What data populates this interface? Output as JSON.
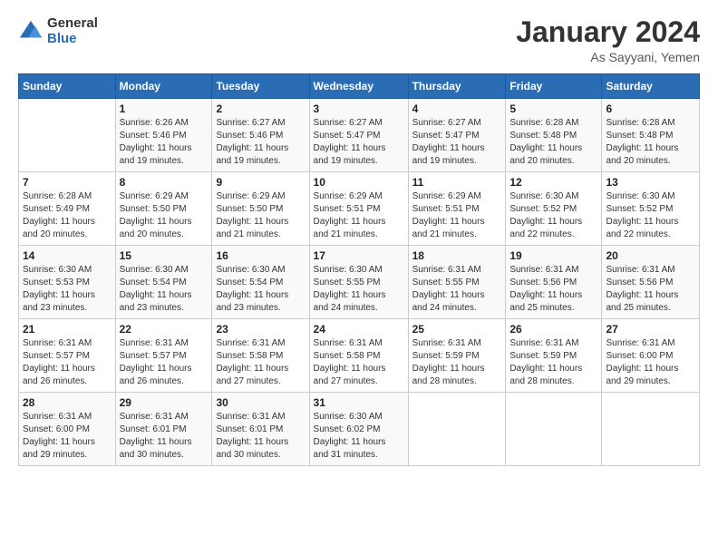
{
  "header": {
    "logo_general": "General",
    "logo_blue": "Blue",
    "month_title": "January 2024",
    "subtitle": "As Sayyani, Yemen"
  },
  "days_of_week": [
    "Sunday",
    "Monday",
    "Tuesday",
    "Wednesday",
    "Thursday",
    "Friday",
    "Saturday"
  ],
  "weeks": [
    [
      {
        "day": "",
        "info": ""
      },
      {
        "day": "1",
        "info": "Sunrise: 6:26 AM\nSunset: 5:46 PM\nDaylight: 11 hours\nand 19 minutes."
      },
      {
        "day": "2",
        "info": "Sunrise: 6:27 AM\nSunset: 5:46 PM\nDaylight: 11 hours\nand 19 minutes."
      },
      {
        "day": "3",
        "info": "Sunrise: 6:27 AM\nSunset: 5:47 PM\nDaylight: 11 hours\nand 19 minutes."
      },
      {
        "day": "4",
        "info": "Sunrise: 6:27 AM\nSunset: 5:47 PM\nDaylight: 11 hours\nand 19 minutes."
      },
      {
        "day": "5",
        "info": "Sunrise: 6:28 AM\nSunset: 5:48 PM\nDaylight: 11 hours\nand 20 minutes."
      },
      {
        "day": "6",
        "info": "Sunrise: 6:28 AM\nSunset: 5:48 PM\nDaylight: 11 hours\nand 20 minutes."
      }
    ],
    [
      {
        "day": "7",
        "info": ""
      },
      {
        "day": "8",
        "info": "Sunrise: 6:29 AM\nSunset: 5:50 PM\nDaylight: 11 hours\nand 20 minutes."
      },
      {
        "day": "9",
        "info": "Sunrise: 6:29 AM\nSunset: 5:50 PM\nDaylight: 11 hours\nand 21 minutes."
      },
      {
        "day": "10",
        "info": "Sunrise: 6:29 AM\nSunset: 5:51 PM\nDaylight: 11 hours\nand 21 minutes."
      },
      {
        "day": "11",
        "info": "Sunrise: 6:29 AM\nSunset: 5:51 PM\nDaylight: 11 hours\nand 21 minutes."
      },
      {
        "day": "12",
        "info": "Sunrise: 6:30 AM\nSunset: 5:52 PM\nDaylight: 11 hours\nand 22 minutes."
      },
      {
        "day": "13",
        "info": "Sunrise: 6:30 AM\nSunset: 5:52 PM\nDaylight: 11 hours\nand 22 minutes."
      }
    ],
    [
      {
        "day": "14",
        "info": ""
      },
      {
        "day": "15",
        "info": "Sunrise: 6:30 AM\nSunset: 5:54 PM\nDaylight: 11 hours\nand 23 minutes."
      },
      {
        "day": "16",
        "info": "Sunrise: 6:30 AM\nSunset: 5:54 PM\nDaylight: 11 hours\nand 23 minutes."
      },
      {
        "day": "17",
        "info": "Sunrise: 6:30 AM\nSunset: 5:55 PM\nDaylight: 11 hours\nand 24 minutes."
      },
      {
        "day": "18",
        "info": "Sunrise: 6:31 AM\nSunset: 5:55 PM\nDaylight: 11 hours\nand 24 minutes."
      },
      {
        "day": "19",
        "info": "Sunrise: 6:31 AM\nSunset: 5:56 PM\nDaylight: 11 hours\nand 25 minutes."
      },
      {
        "day": "20",
        "info": "Sunrise: 6:31 AM\nSunset: 5:56 PM\nDaylight: 11 hours\nand 25 minutes."
      }
    ],
    [
      {
        "day": "21",
        "info": ""
      },
      {
        "day": "22",
        "info": "Sunrise: 6:31 AM\nSunset: 5:57 PM\nDaylight: 11 hours\nand 26 minutes."
      },
      {
        "day": "23",
        "info": "Sunrise: 6:31 AM\nSunset: 5:58 PM\nDaylight: 11 hours\nand 27 minutes."
      },
      {
        "day": "24",
        "info": "Sunrise: 6:31 AM\nSunset: 5:58 PM\nDaylight: 11 hours\nand 27 minutes."
      },
      {
        "day": "25",
        "info": "Sunrise: 6:31 AM\nSunset: 5:59 PM\nDaylight: 11 hours\nand 28 minutes."
      },
      {
        "day": "26",
        "info": "Sunrise: 6:31 AM\nSunset: 5:59 PM\nDaylight: 11 hours\nand 28 minutes."
      },
      {
        "day": "27",
        "info": "Sunrise: 6:31 AM\nSunset: 6:00 PM\nDaylight: 11 hours\nand 29 minutes."
      }
    ],
    [
      {
        "day": "28",
        "info": "Sunrise: 6:31 AM\nSunset: 6:00 PM\nDaylight: 11 hours\nand 29 minutes."
      },
      {
        "day": "29",
        "info": "Sunrise: 6:31 AM\nSunset: 6:01 PM\nDaylight: 11 hours\nand 30 minutes."
      },
      {
        "day": "30",
        "info": "Sunrise: 6:31 AM\nSunset: 6:01 PM\nDaylight: 11 hours\nand 30 minutes."
      },
      {
        "day": "31",
        "info": "Sunrise: 6:30 AM\nSunset: 6:02 PM\nDaylight: 11 hours\nand 31 minutes."
      },
      {
        "day": "",
        "info": ""
      },
      {
        "day": "",
        "info": ""
      },
      {
        "day": "",
        "info": ""
      }
    ]
  ],
  "week1_day7_info": "Sunrise: 6:28 AM\nSunset: 5:49 PM\nDaylight: 11 hours\nand 20 minutes.",
  "week2_day14_info": "Sunrise: 6:30 AM\nSunset: 5:53 PM\nDaylight: 11 hours\nand 23 minutes.",
  "week3_day21_info": "Sunrise: 6:31 AM\nSunset: 5:57 PM\nDaylight: 11 hours\nand 26 minutes."
}
